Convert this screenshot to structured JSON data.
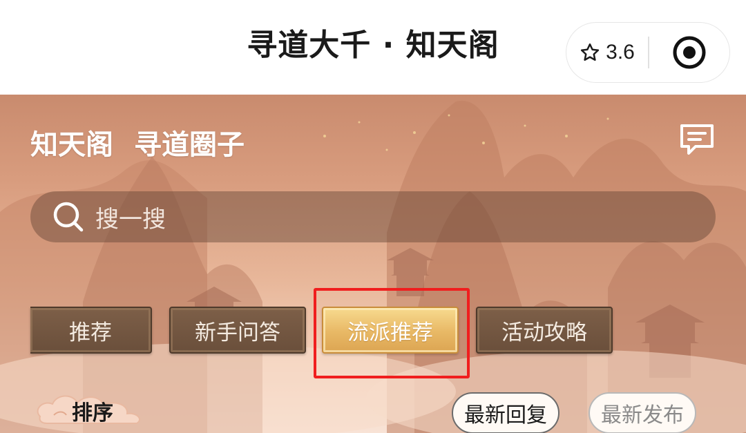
{
  "app": {
    "title": "寻道大千 · 知天阁",
    "rating": "3.6"
  },
  "banner": {
    "title_primary": "知天阁",
    "title_secondary": "寻道圈子"
  },
  "search": {
    "placeholder": "搜一搜"
  },
  "tabs": [
    {
      "label": "推荐",
      "active": false
    },
    {
      "label": "新手问答",
      "active": false
    },
    {
      "label": "流派推荐",
      "active": true
    },
    {
      "label": "活动攻略",
      "active": false
    }
  ],
  "sort": {
    "label": "排序",
    "options": [
      {
        "label": "最新回复",
        "selected": true
      },
      {
        "label": "最新发布",
        "selected": false
      }
    ]
  },
  "icons": {
    "rating": "star-outline-icon",
    "close": "target-circle-icon",
    "message": "message-bubble-icon",
    "search": "search-icon",
    "sort_decoration": "cloud-ornament-icon"
  },
  "colors": {
    "highlight": "#f01e1e",
    "active_tab": "#e8b865",
    "inactive_tab": "#6a4f3b"
  }
}
